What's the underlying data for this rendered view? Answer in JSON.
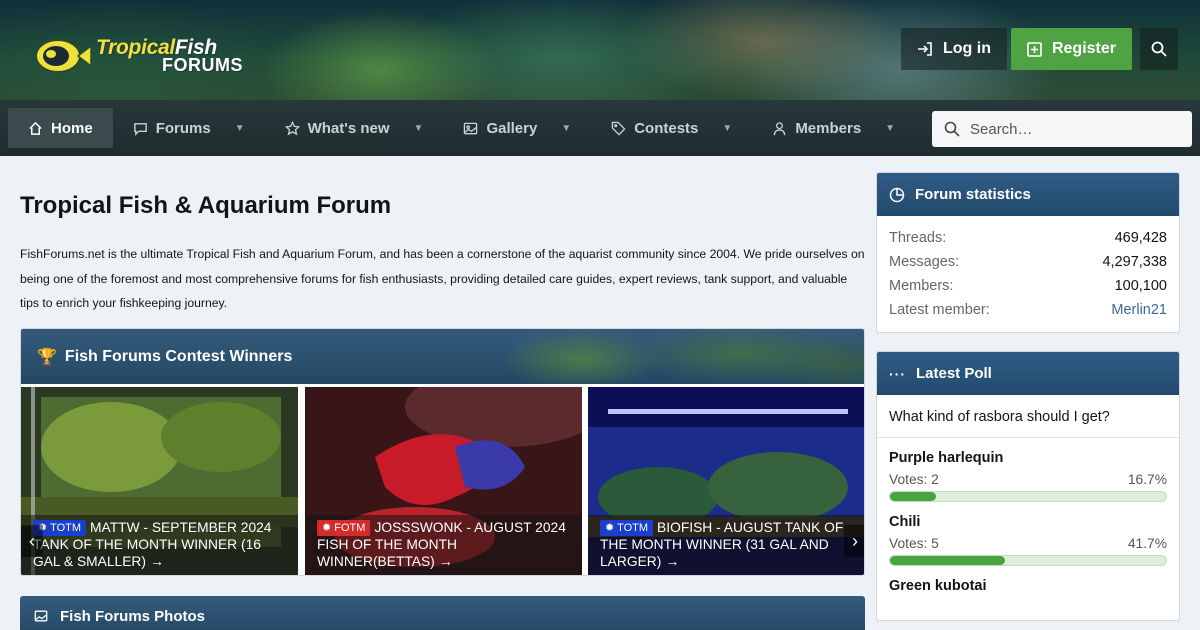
{
  "site": {
    "logo_line1_a": "Tropical",
    "logo_line1_b": "Fish",
    "logo_line2": "FORUMS"
  },
  "header": {
    "login_label": "Log in",
    "register_label": "Register"
  },
  "nav": {
    "items": [
      {
        "label": "Home",
        "icon": "home-icon"
      },
      {
        "label": "Forums",
        "icon": "chat-icon"
      },
      {
        "label": "What's new",
        "icon": "star-icon"
      },
      {
        "label": "Gallery",
        "icon": "image-icon"
      },
      {
        "label": "Contests",
        "icon": "tag-icon"
      },
      {
        "label": "Members",
        "icon": "user-icon"
      }
    ],
    "search_placeholder": "Search…"
  },
  "main": {
    "title": "Tropical Fish & Aquarium Forum",
    "intro": "FishForums.net is the ultimate Tropical Fish and Aquarium Forum, and has been a cornerstone of the aquarist community since 2004. We pride ourselves on being one of the foremost and most comprehensive forums for fish enthusiasts, providing detailed care guides, expert reviews, tank support, and valuable tips to enrich your fishkeeping journey.",
    "contest": {
      "title": "Fish Forums Contest Winners",
      "slides": [
        {
          "badge": "TOTM",
          "badge_color": "#1a3fcc",
          "text": "MATTW - SEPTEMBER 2024 TANK OF THE MONTH WINNER (16 GAL & SMALLER)"
        },
        {
          "badge": "FOTM",
          "badge_color": "#d42c2c",
          "text": "JOSSSWONK - AUGUST 2024 FISH OF THE MONTH WINNER(BETTAS)"
        },
        {
          "badge": "TOTM",
          "badge_color": "#1a3fcc",
          "text": "BIOFISH - AUGUST TANK OF THE MONTH WINNER (31 GAL AND LARGER)"
        }
      ]
    },
    "photos_title": "Fish Forums Photos"
  },
  "sidebar": {
    "stats": {
      "title": "Forum statistics",
      "rows": [
        {
          "label": "Threads:",
          "value": "469,428"
        },
        {
          "label": "Messages:",
          "value": "4,297,338"
        },
        {
          "label": "Members:",
          "value": "100,100"
        },
        {
          "label": "Latest member:",
          "value": "Merlin21"
        }
      ]
    },
    "poll": {
      "title": "Latest Poll",
      "question": "What kind of rasbora should I get?",
      "options": [
        {
          "name": "Purple harlequin",
          "votes": "Votes: 2",
          "percent": "16.7%",
          "fraction": 0.167
        },
        {
          "name": "Chili",
          "votes": "Votes: 5",
          "percent": "41.7%",
          "fraction": 0.417
        },
        {
          "name": "Green kubotai",
          "votes": "",
          "percent": "",
          "fraction": 0
        }
      ]
    }
  },
  "colors": {
    "accent": "#244863",
    "register": "#4fa342",
    "poll_bar": "#47a441",
    "link": "#3a68a0"
  }
}
